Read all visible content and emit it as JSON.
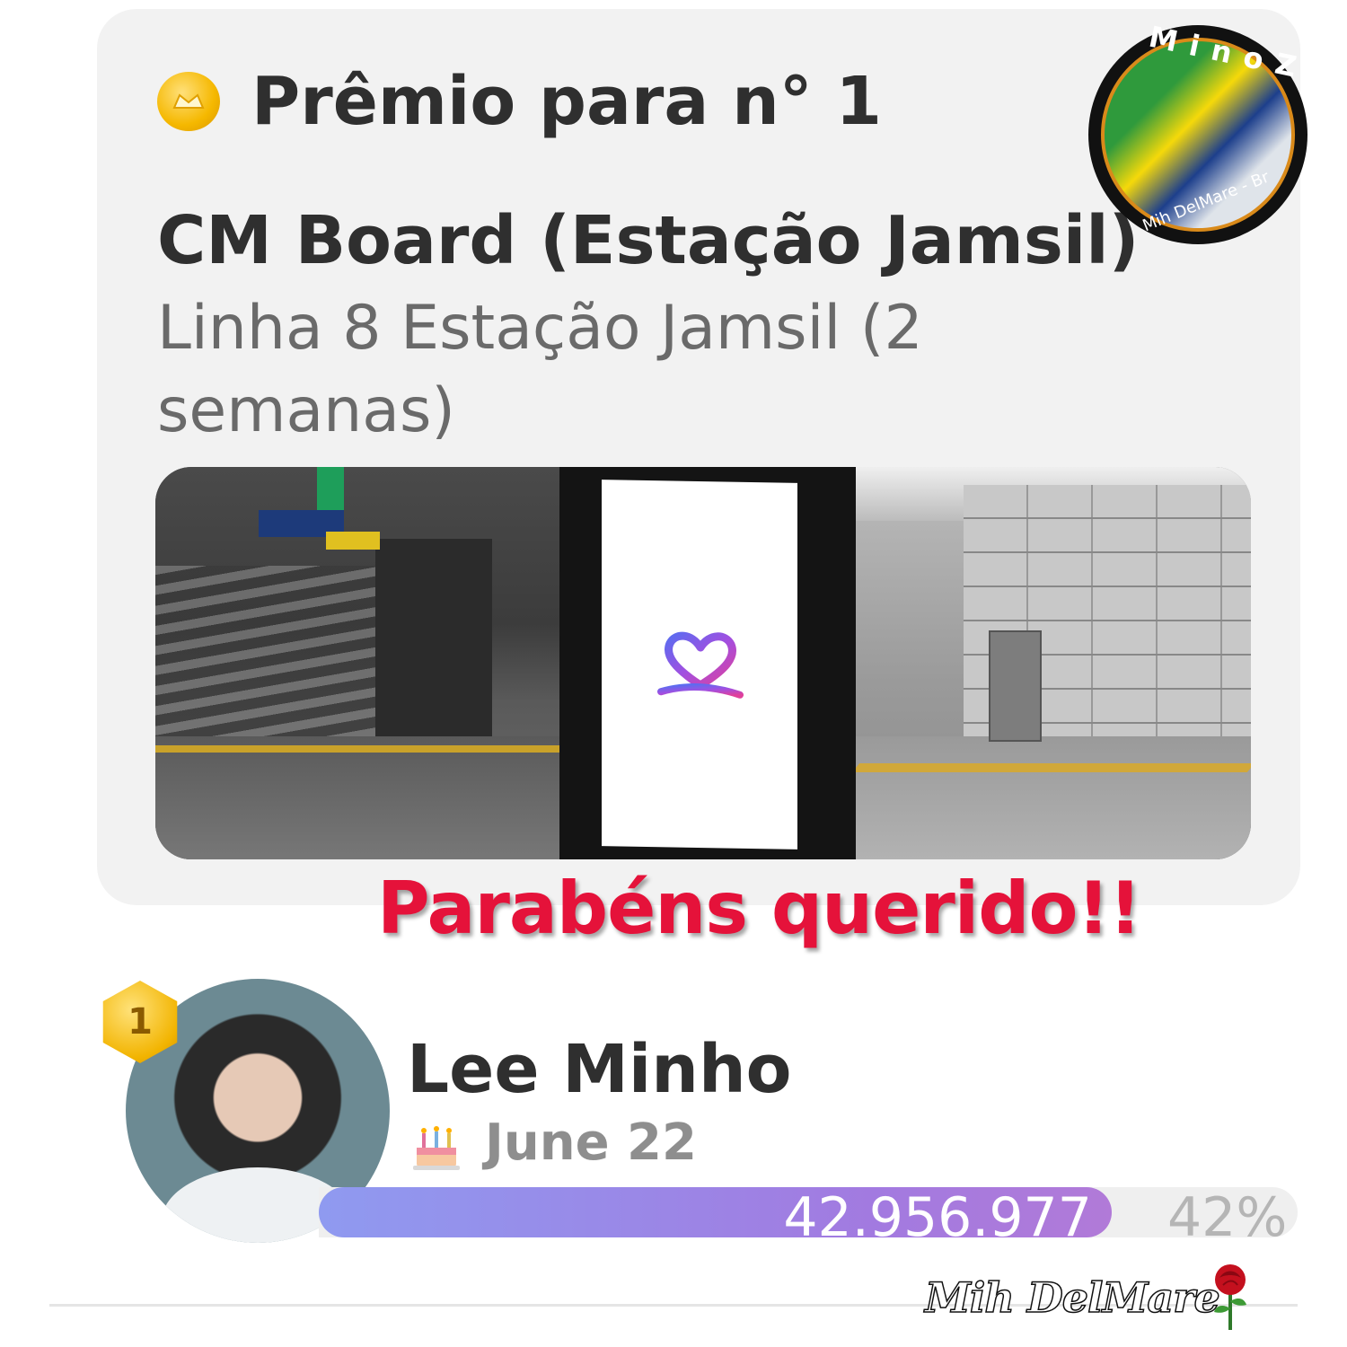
{
  "prize": {
    "title": "Prêmio para n° 1",
    "board_name": "CM Board (Estação Jamsil)",
    "location": "Linha 8 Estação Jamsil (2 semanas)"
  },
  "watermark": {
    "ring_text": "MinoZ",
    "bottom_text": "Mih DelMare - Br"
  },
  "congrats": "Parabéns querido!!",
  "ranking": {
    "rank": "1",
    "artist_name": "Lee Minho",
    "birthday": "June 22",
    "votes": "42.956.977",
    "percent_label": "42%",
    "progress_fraction": 0.81
  },
  "signature": "Mih DelMare",
  "icons": {
    "coin": "coin-icon",
    "cake": "birthday-cake-icon",
    "rose": "rose-icon",
    "heart_logo": "heart-logo-icon"
  },
  "colors": {
    "congrats": "#e5123a",
    "bar_start": "#8f9af0",
    "bar_end": "#b17ad8",
    "coin": "#f5b800"
  }
}
